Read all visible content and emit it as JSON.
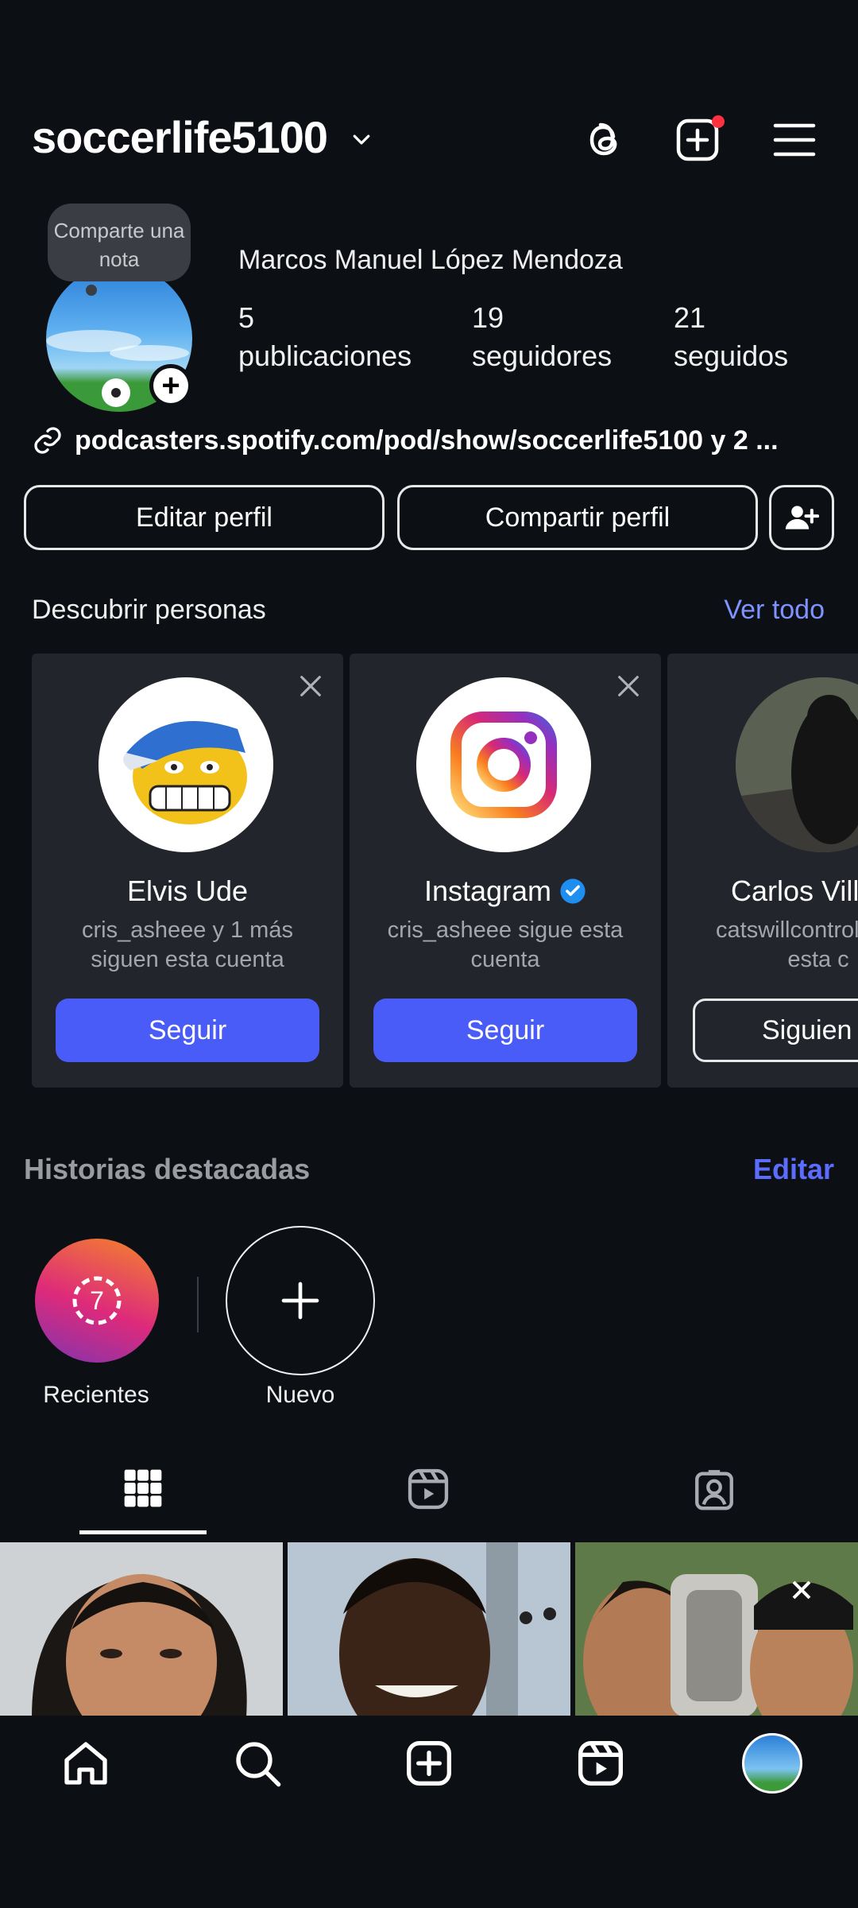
{
  "header": {
    "username": "soccerlife5100",
    "icons": [
      "chevron-down-icon",
      "threads-icon",
      "create-post-icon",
      "menu-icon"
    ],
    "notification_color": "#ff3040"
  },
  "profile": {
    "note_text": "Comparte una nota",
    "full_name": "Marcos Manuel López Mendoza",
    "stats": {
      "posts": {
        "value": "5",
        "label": "publicaciones"
      },
      "followers": {
        "value": "19",
        "label": "seguidores"
      },
      "following": {
        "value": "21",
        "label": "seguidos"
      }
    },
    "link": "podcasters.spotify.com/pod/show/soccerlife5100 y 2 ..."
  },
  "actions": {
    "edit_profile": "Editar perfil",
    "share_profile": "Compartir perfil"
  },
  "discover": {
    "title": "Descubrir personas",
    "see_all": "Ver todo",
    "cards": [
      {
        "name": "Elvis Ude",
        "sub": "cris_asheee y 1 más siguen esta cuenta",
        "button": "Seguir"
      },
      {
        "name": "Instagram",
        "sub": "cris_asheee sigue esta cuenta",
        "button": "Seguir",
        "verified": true
      },
      {
        "name": "Carlos Ville",
        "sub": "catswillcontrol sigue esta c",
        "button": "Siguien"
      }
    ]
  },
  "highlights": {
    "title": "Historias destacadas",
    "edit": "Editar",
    "items": [
      {
        "label": "Recientes",
        "badge": "7"
      },
      {
        "label": "Nuevo"
      }
    ]
  },
  "tabs": [
    "grid-icon",
    "reels-icon",
    "tagged-icon"
  ],
  "bottom_nav": [
    "home-icon",
    "search-icon",
    "create-icon",
    "reels-icon",
    "profile-avatar"
  ],
  "colors": {
    "background": "#0c0f14",
    "accent_blue": "#4a5cf7",
    "link_blue": "#7f93ff"
  }
}
